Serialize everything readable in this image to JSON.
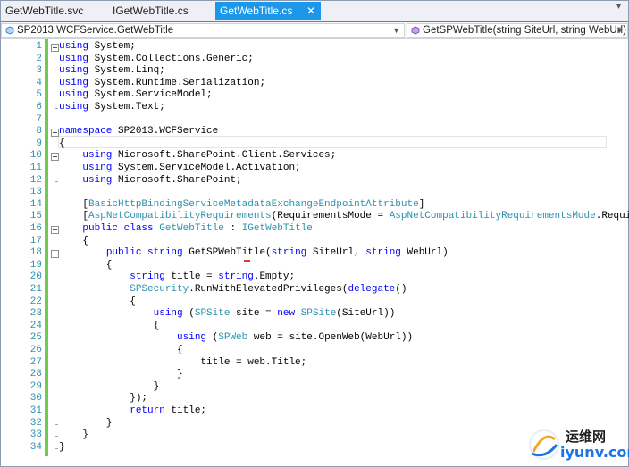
{
  "tabs": [
    {
      "label": "GetWebTitle.svc",
      "active": false
    },
    {
      "label": "IGetWebTitle.cs",
      "active": false
    },
    {
      "label": "GetWebTitle.cs",
      "active": true
    }
  ],
  "tab_close_glyph": "✕",
  "tab_overflow_glyph": "▾",
  "navbar": {
    "left_label": "SP2013.WCFService.GetWebTitle",
    "right_label": "GetSPWebTitle(string SiteUrl, string WebUrl)",
    "left_icon": "class-icon",
    "right_icon": "method-icon"
  },
  "colors": {
    "accent": "#1c97ea",
    "keyword": "#0000ff",
    "type": "#2b91af",
    "change_bar": "#6ecb4c"
  },
  "code_lines": [
    "using System;",
    "using System.Collections.Generic;",
    "using System.Linq;",
    "using System.Runtime.Serialization;",
    "using System.ServiceModel;",
    "using System.Text;",
    "",
    "namespace SP2013.WCFService",
    "{",
    "    using Microsoft.SharePoint.Client.Services;",
    "    using System.ServiceModel.Activation;",
    "    using Microsoft.SharePoint;",
    "",
    "    [BasicHttpBindingServiceMetadataExchangeEndpointAttribute]",
    "    [AspNetCompatibilityRequirements(RequirementsMode = AspNetCompatibilityRequirementsMode.Required)]",
    "    public class GetWebTitle : IGetWebTitle",
    "    {",
    "        public string GetSPWebTitle(string SiteUrl, string WebUrl)",
    "        {",
    "            string title = string.Empty;",
    "            SPSecurity.RunWithElevatedPrivileges(delegate()",
    "            {",
    "                using (SPSite site = new SPSite(SiteUrl))",
    "                {",
    "                    using (SPWeb web = site.OpenWeb(WebUrl))",
    "                    {",
    "                        title = web.Title;",
    "                    }",
    "                }",
    "            });",
    "            return title;",
    "        }",
    "    }",
    "}"
  ],
  "watermark": {
    "chinese": "运维网",
    "site": "iyunv.com"
  }
}
